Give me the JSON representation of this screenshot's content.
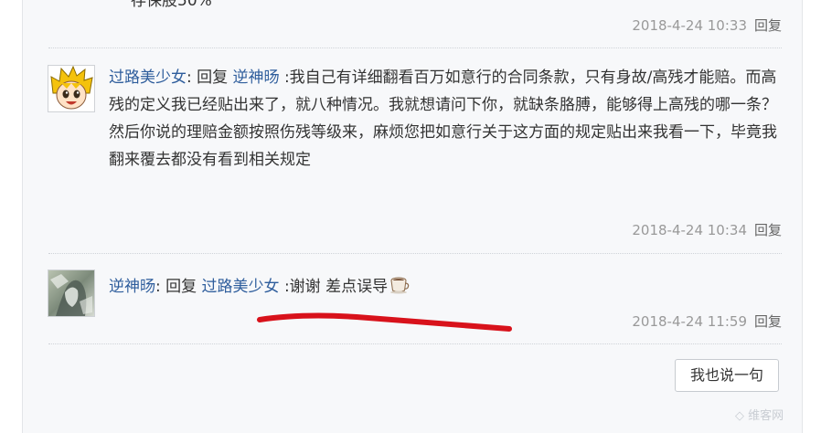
{
  "top": {
    "partial_text": "存保股50%",
    "time": "2018-4-24 10:33",
    "reply_label": "回复"
  },
  "comments": [
    {
      "author": "过路美少女",
      "colon": ": ",
      "action": "回复",
      "target": "逆神旸",
      "content": " :我自己有详细翻看百万如意行的合同条款，只有身故/高残才能赔。而高残的定义我已经贴出来了，就八种情况。我就想请问下你，就缺条胳膊，能够得上高残的哪一条？ 然后你说的理赔金额按照伤残等级来，麻烦您把如意行关于这方面的规定贴出来我看一下，毕竟我翻来覆去都没有看到相关规定",
      "time": "2018-4-24 10:34",
      "reply_label": "回复"
    },
    {
      "author": "逆神旸",
      "colon": ": ",
      "action": "回复",
      "target": "过路美少女",
      "content": " :谢谢 差点误导",
      "emoji": "coffee-icon",
      "time": "2018-4-24 11:59",
      "reply_label": "回复"
    }
  ],
  "say_button": "我也说一句",
  "watermark": "维客网",
  "colors": {
    "link": "#2e5d9c",
    "meta": "#999999",
    "mark": "#d8121b",
    "panel": "#f7f8fa"
  }
}
